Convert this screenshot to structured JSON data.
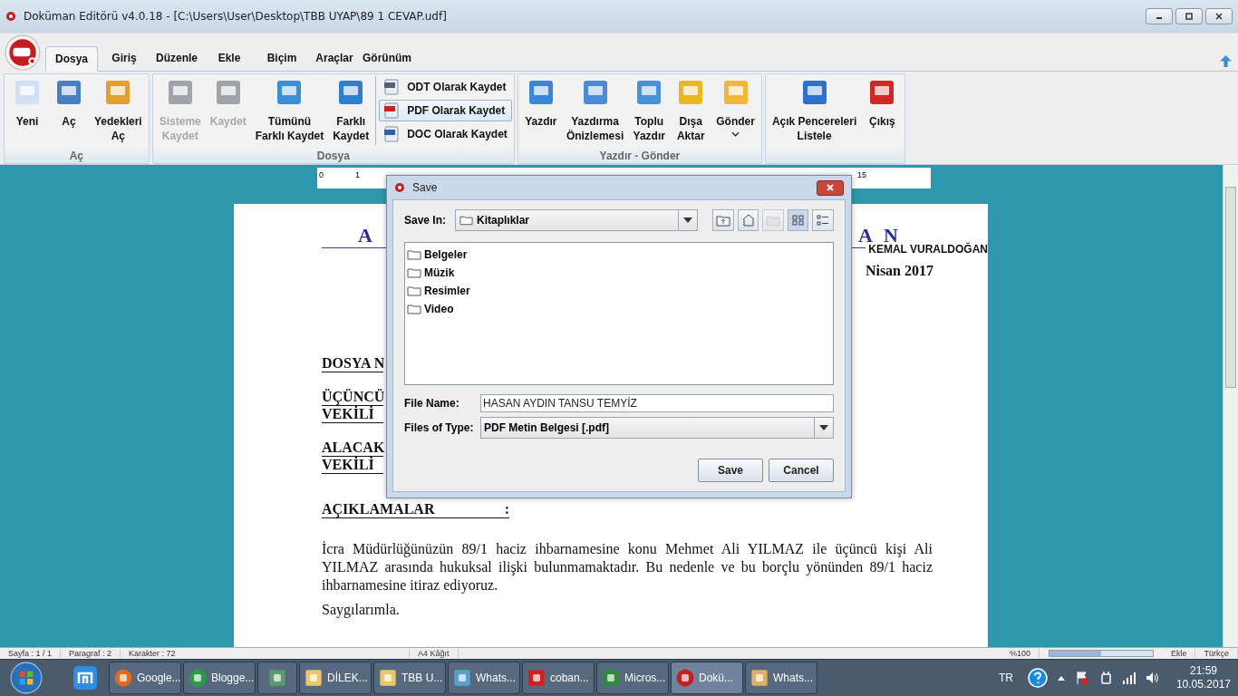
{
  "window": {
    "title": "Doküman Editörü v4.0.18 - [C:\\Users\\User\\Desktop\\TBB UYAP\\89 1 CEVAP.udf]"
  },
  "tabs": [
    {
      "label": "Dosya",
      "selected": true
    },
    {
      "label": "Giriş",
      "selected": false
    },
    {
      "label": "Düzenle",
      "selected": false
    },
    {
      "label": "Ekle",
      "selected": false
    },
    {
      "label": "Biçim",
      "selected": false
    },
    {
      "label": "Araçlar",
      "selected": false
    },
    {
      "label": "Görünüm",
      "selected": false
    }
  ],
  "ribbon": {
    "groups": [
      {
        "label": "Aç",
        "buttons": [
          {
            "lines": [
              "Yeni"
            ],
            "disabled": false
          },
          {
            "lines": [
              "Aç"
            ],
            "disabled": false
          },
          {
            "lines": [
              "Yedekleri",
              "Aç"
            ],
            "disabled": false
          }
        ]
      },
      {
        "label": "Dosya",
        "buttons": [
          {
            "lines": [
              "Sisteme",
              "Kaydet"
            ],
            "disabled": true
          },
          {
            "lines": [
              "Kaydet"
            ],
            "disabled": true
          },
          {
            "lines": [
              "Tümünü",
              "Farklı Kaydet"
            ],
            "disabled": false
          },
          {
            "lines": [
              "Farklı",
              "Kaydet"
            ],
            "disabled": false
          }
        ],
        "small_buttons": [
          {
            "label": "ODT Olarak Kaydet",
            "selected": false
          },
          {
            "label": "PDF Olarak Kaydet",
            "selected": true
          },
          {
            "label": "DOC Olarak Kaydet",
            "selected": false
          }
        ]
      },
      {
        "label": "Yazdır - Gönder",
        "buttons": [
          {
            "lines": [
              "Yazdır"
            ],
            "disabled": false
          },
          {
            "lines": [
              "Yazdırma",
              "Önizlemesi"
            ],
            "disabled": false
          },
          {
            "lines": [
              "Toplu",
              "Yazdır"
            ],
            "disabled": false
          },
          {
            "lines": [
              "Dışa",
              "Aktar"
            ],
            "disabled": false
          },
          {
            "lines": [
              "Gönder"
            ],
            "disabled": false,
            "dropdown": true
          }
        ]
      },
      {
        "buttons": [
          {
            "lines": [
              "Açık Pencereleri",
              "Listele"
            ],
            "disabled": false
          },
          {
            "lines": [
              "Çıkış"
            ],
            "disabled": false
          }
        ]
      }
    ]
  },
  "ruler": {
    "marks": [
      "0",
      "1",
      "15"
    ]
  },
  "document": {
    "heading_left": "A",
    "heading_right": "A N",
    "author": "KEMAL VURALDOĞAN",
    "date": "Nisan 2017",
    "labels": [
      "DOSYA N",
      "ÜÇÜNCÜ",
      "VEKİLİ",
      "ALACAK",
      "VEKİLİ"
    ],
    "section": "AÇIKLAMALAR",
    "section_colon": ":",
    "paragraph": "İcra Müdürlüğünüzün 89/1 haciz ihbarnamesine konu Mehmet Ali YILMAZ ile üçüncü kişi Ali YILMAZ arasında hukuksal ilişki bulunmamaktadır. Bu nedenle ve bu borçlu yönünden 89/1 haciz ihbarnamesine itiraz ediyoruz.",
    "closing": "Saygılarımla."
  },
  "dialog": {
    "title": "Save",
    "save_in_label": "Save In:",
    "save_in": "Kitaplıklar",
    "folders": [
      "Belgeler",
      "Müzik",
      "Resimler",
      "Video"
    ],
    "file_name_label": "File Name:",
    "file_name": "HASAN AYDIN TANSU TEMYİZ",
    "file_type_label": "Files of Type:",
    "file_type": "PDF Metin Belgesi [.pdf]",
    "buttons": [
      "Save",
      "Cancel"
    ]
  },
  "status_bar": {
    "page": "Sayfa : 1 / 1",
    "paragraph": "Paragraf : 2",
    "characters": "Karakter : 72",
    "paper": "A4 Kâğıt",
    "zoom": "%100",
    "zoom_slider": {
      "level": 0.5
    },
    "mode": "Ekle",
    "language": "Türkçe"
  },
  "taskbar": {
    "items": [
      {
        "label": "Google...",
        "selected": false
      },
      {
        "label": "Blogge...",
        "selected": false
      },
      {
        "selected": false
      },
      {
        "label": "DİLEK...",
        "selected": false
      },
      {
        "label": "TBB U...",
        "selected": false
      },
      {
        "label": "Whats...",
        "selected": false
      },
      {
        "label": "coban...",
        "selected": false
      },
      {
        "label": "Micros...",
        "selected": false
      },
      {
        "label": "Dokü...",
        "selected": true
      },
      {
        "label": "Whats...",
        "selected": false
      }
    ],
    "language": "TR",
    "time": "21:59",
    "date": "10.05.2017"
  }
}
